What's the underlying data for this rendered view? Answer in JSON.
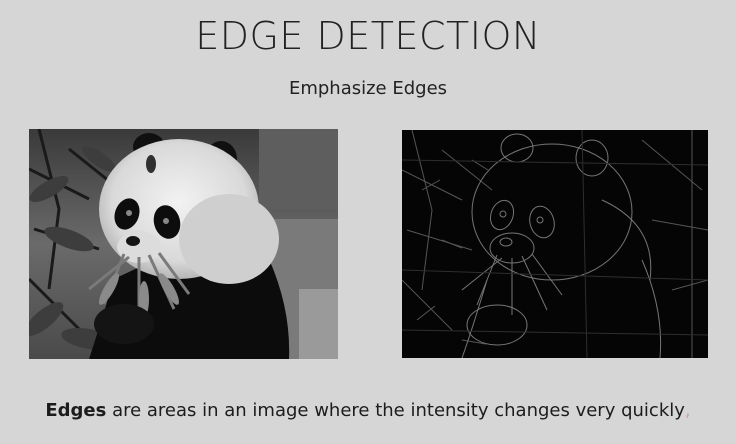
{
  "slide": {
    "title": "EDGE DETECTION",
    "subtitle": "Emphasize Edges"
  },
  "images": {
    "original": {
      "subject": "grayscale photo of a panda eating bamboo"
    },
    "edges": {
      "subject": "edge-detected version of the panda photo (bright outlines on black)"
    }
  },
  "caption": {
    "bold_term": "Edges",
    "text": " are areas in an image where the intensity changes very quickly",
    "trailing_punct": ","
  },
  "colors": {
    "background": "#d6d6d6",
    "text": "#1f1f1f",
    "edge_background": "#050505"
  }
}
